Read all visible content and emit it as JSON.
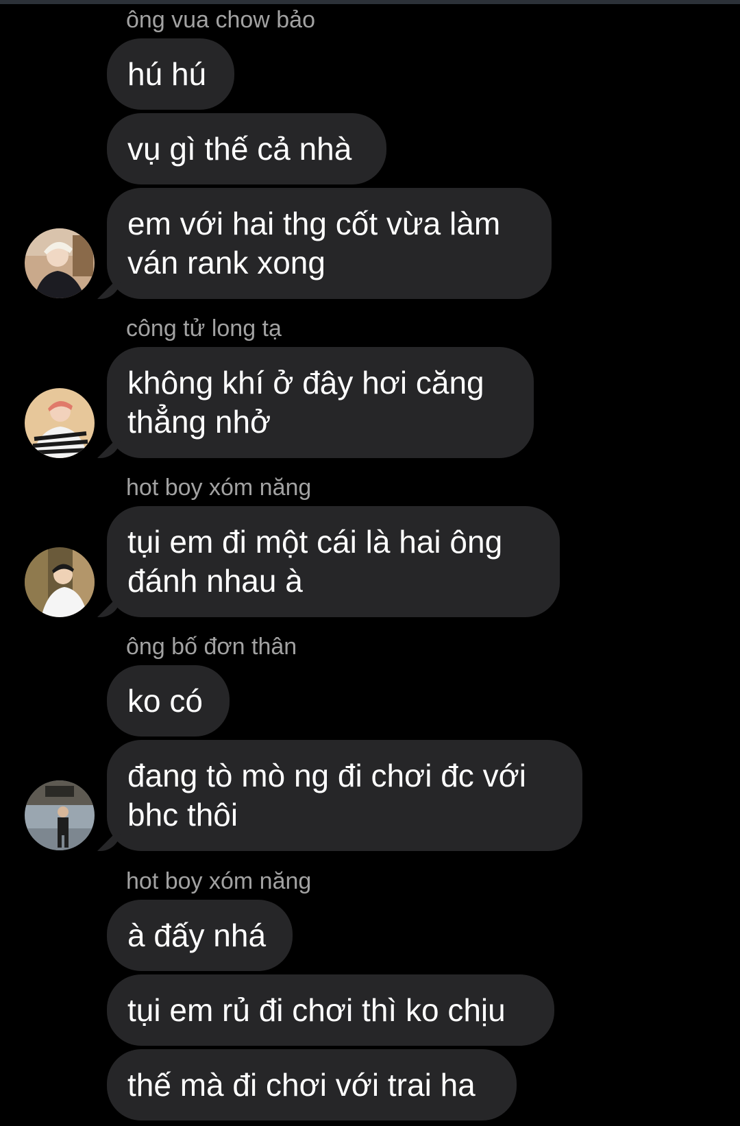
{
  "conversation": {
    "groups": [
      {
        "sender": "ông vua chow bảo",
        "messages": [
          "hú hú",
          "vụ gì thế cả nhà",
          "em với hai thg cốt vừa làm\nván rank xong"
        ]
      },
      {
        "sender": "công tử long tạ",
        "messages": [
          "không khí ở đây hơi căng\nthẳng nhở"
        ]
      },
      {
        "sender": "hot boy xóm năng",
        "messages": [
          "tụi em đi một cái là hai ông\nđánh nhau à"
        ]
      },
      {
        "sender": "ông bố đơn thân",
        "messages": [
          "ko có",
          "đang tò mò ng đi chơi đc với\nbhc thôi"
        ]
      },
      {
        "sender": "hot boy xóm năng",
        "messages": [
          "à đấy nhá",
          "tụi em rủ đi chơi thì ko chịu",
          "thế mà đi chơi với trai ha"
        ]
      }
    ]
  },
  "colors": {
    "background": "#000000",
    "bubble": "#262628",
    "sender_name": "#a2a2a2",
    "message_text": "#ffffff"
  }
}
